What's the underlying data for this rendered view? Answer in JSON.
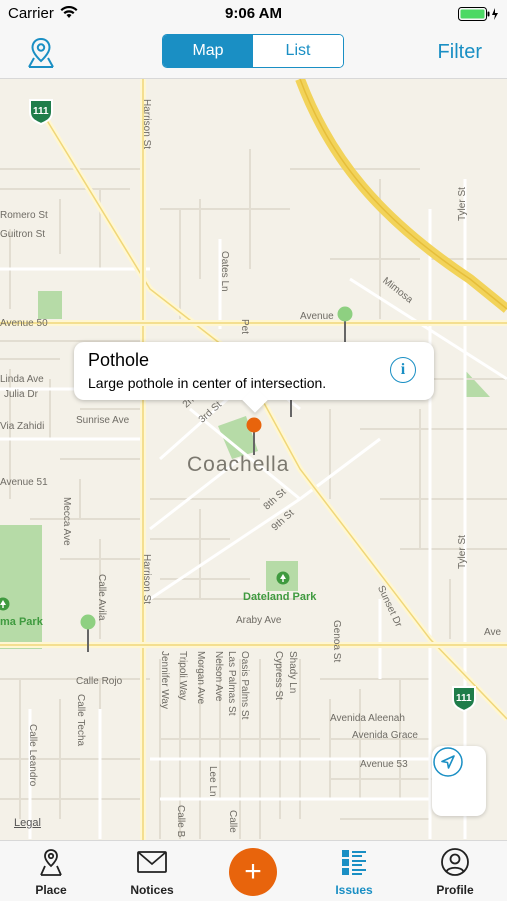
{
  "status": {
    "carrier": "Carrier",
    "time": "9:06 AM"
  },
  "nav": {
    "segments": [
      "Map",
      "List"
    ],
    "active_segment": "Map",
    "filter_label": "Filter"
  },
  "map": {
    "city": "Coachella",
    "route_shields": [
      "111",
      "111"
    ],
    "street_labels": [
      "Romero St",
      "Guitron St",
      "Avenue 50",
      "Linda Ave",
      "Julia Dr",
      "Sunrise Ave",
      "Via Zahidi",
      "Avenue 51",
      "Mecca Ave",
      "Harrison St",
      "Harrison St",
      "Oates Ln",
      "Tyler St",
      "Tyler St",
      "Mimosa",
      "Avenue",
      "3rd St",
      "2n",
      "8th St",
      "9th St",
      "Araby Ave",
      "Calle Avila",
      "Calle Rojo",
      "Calle Techa",
      "Calle Leandro",
      "Jennifer Way",
      "Tripoli Way",
      "Morgan Ave",
      "Nelson Ave",
      "Las Palmas St",
      "Oasis Palms St",
      "Cypress St",
      "Shady Ln",
      "Genoa St",
      "Sunset Dr",
      "Avenida Aleenah",
      "Avenida Grace",
      "Avenue 53",
      "Lee Ln",
      "Calle B",
      "Calle",
      "Pet",
      "Ave"
    ],
    "parks": [
      "Dateland Park",
      "ma Park"
    ],
    "legal_label": "Legal"
  },
  "callout": {
    "title": "Pothole",
    "description": "Large pothole in center of intersection.",
    "info_glyph": "i"
  },
  "tabs": [
    {
      "label": "Place",
      "icon": "place-icon"
    },
    {
      "label": "Notices",
      "icon": "envelope-icon"
    },
    {
      "label": "Issues",
      "icon": "issues-list-icon",
      "active": true
    },
    {
      "label": "Profile",
      "icon": "profile-icon"
    }
  ],
  "fab_glyph": "+",
  "colors": {
    "accent": "#1a8fc4",
    "fab": "#e8640c",
    "map_bg": "#f4f1e8",
    "highway": "#f2d35a",
    "park": "#b6dba7",
    "pin_green": "#8ed081",
    "pin_orange": "#e8640c"
  }
}
